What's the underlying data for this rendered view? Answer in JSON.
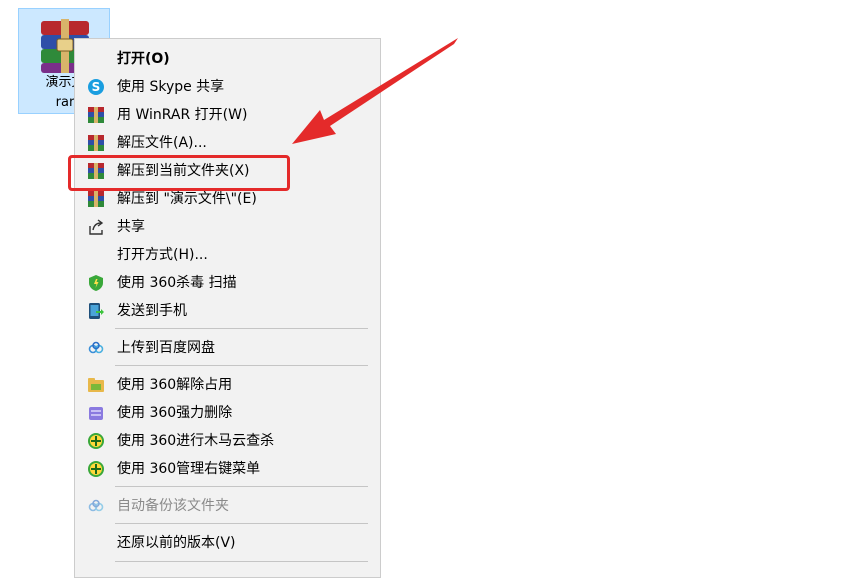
{
  "desktop_file": {
    "name_line1": "演示文",
    "name_line2": "rar",
    "icon": "winrar-archive-icon"
  },
  "menu": {
    "items": [
      {
        "id": "open",
        "label": "打开(O)",
        "icon": null,
        "bold": true,
        "disabled": false
      },
      {
        "id": "skype",
        "label": "使用 Skype 共享",
        "icon": "skype-icon",
        "bold": false,
        "disabled": false
      },
      {
        "id": "winrar-open",
        "label": "用 WinRAR 打开(W)",
        "icon": "winrar-icon",
        "bold": false,
        "disabled": false
      },
      {
        "id": "extract-files",
        "label": "解压文件(A)...",
        "icon": "winrar-icon",
        "bold": false,
        "disabled": false
      },
      {
        "id": "extract-here",
        "label": "解压到当前文件夹(X)",
        "icon": "winrar-icon",
        "bold": false,
        "disabled": false
      },
      {
        "id": "extract-to",
        "label": "解压到 \"演示文件\\\"(E)",
        "icon": "winrar-icon",
        "bold": false,
        "disabled": false
      },
      {
        "id": "share",
        "label": "共享",
        "icon": "share-icon",
        "bold": false,
        "disabled": false
      },
      {
        "id": "open-with",
        "label": "打开方式(H)...",
        "icon": null,
        "bold": false,
        "disabled": false
      },
      {
        "id": "scan-360",
        "label": "使用 360杀毒 扫描",
        "icon": "shield-icon",
        "bold": false,
        "disabled": false
      },
      {
        "id": "send-phone",
        "label": "发送到手机",
        "icon": "phone-icon",
        "bold": false,
        "disabled": false
      },
      {
        "id": "baidu-upload",
        "label": "上传到百度网盘",
        "icon": "cloud-icon",
        "bold": false,
        "disabled": false
      },
      {
        "id": "unlock-360",
        "label": "使用 360解除占用",
        "icon": "unlock-icon",
        "bold": false,
        "disabled": false
      },
      {
        "id": "force-delete-360",
        "label": "使用 360强力删除",
        "icon": "delete-icon",
        "bold": false,
        "disabled": false
      },
      {
        "id": "trojan-scan-360",
        "label": "使用 360进行木马云查杀",
        "icon": "plus-circle-icon",
        "bold": false,
        "disabled": false
      },
      {
        "id": "manage-menu-360",
        "label": "使用 360管理右键菜单",
        "icon": "plus-circle-icon",
        "bold": false,
        "disabled": false
      },
      {
        "id": "auto-backup",
        "label": "自动备份该文件夹",
        "icon": "cloud-icon",
        "bold": false,
        "disabled": true
      },
      {
        "id": "restore-prev",
        "label": "还原以前的版本(V)",
        "icon": null,
        "bold": false,
        "disabled": false
      }
    ]
  },
  "annotation": {
    "highlight_color": "#e42a2a",
    "highlighted_item": "extract-here"
  }
}
